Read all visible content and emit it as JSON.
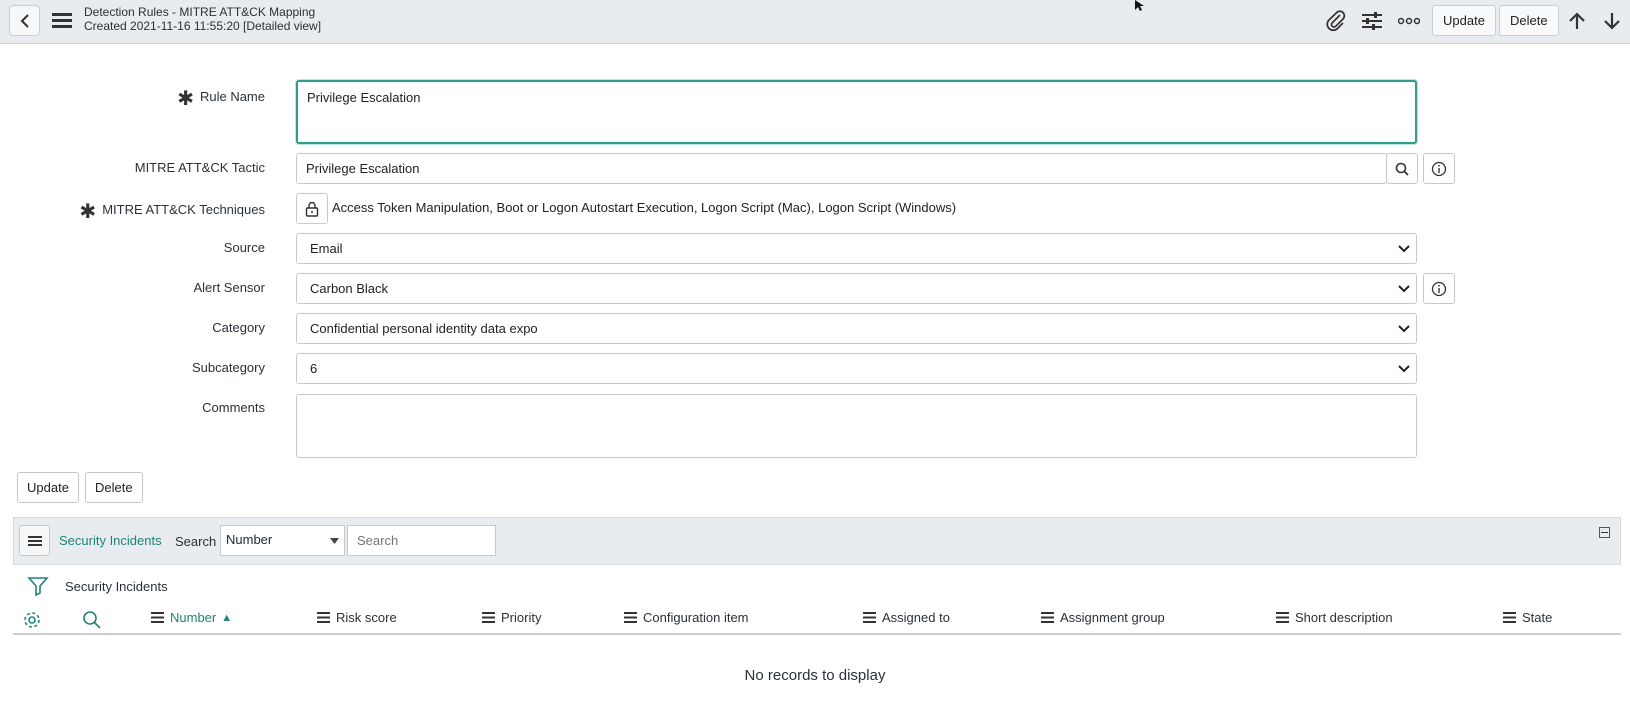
{
  "header": {
    "title": "Detection Rules - MITRE ATT&CK Mapping",
    "subtitle": "Created 2021-11-16 11:55:20 [Detailed view]",
    "update_label": "Update",
    "delete_label": "Delete"
  },
  "form": {
    "rule_name": {
      "label": "Rule Name",
      "value": "Privilege Escalation"
    },
    "tactic": {
      "label": "MITRE ATT&CK Tactic",
      "value": "Privilege Escalation"
    },
    "techniques": {
      "label": "MITRE ATT&CK Techniques",
      "value": "Access Token Manipulation, Boot or Logon Autostart Execution, Logon Script (Mac), Logon Script (Windows)"
    },
    "source": {
      "label": "Source",
      "value": "Email"
    },
    "alert_sensor": {
      "label": "Alert Sensor",
      "value": "Carbon Black"
    },
    "category": {
      "label": "Category",
      "value": "Confidential personal identity data expo"
    },
    "subcategory": {
      "label": "Subcategory",
      "value": "6"
    },
    "comments": {
      "label": "Comments",
      "value": ""
    },
    "update_label": "Update",
    "delete_label": "Delete"
  },
  "related_list": {
    "tab_label": "Security Incidents",
    "search_label": "Search",
    "search_field": "Number",
    "search_placeholder": "Search",
    "list_title": "Security Incidents",
    "columns": [
      "Number",
      "Risk score",
      "Priority",
      "Configuration item",
      "Assigned to",
      "Assignment group",
      "Short description",
      "State"
    ],
    "sort_indicator": "▲",
    "empty_message": "No records to display"
  },
  "colors": {
    "accent": "#1f8476",
    "focus_border": "#2e9e8f",
    "header_bg": "#e9ecee"
  }
}
